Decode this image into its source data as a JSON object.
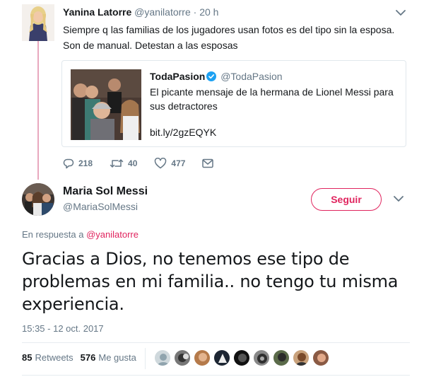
{
  "parent_tweet": {
    "name": "Yanina Latorre",
    "handle": "@yanilatorre",
    "separator": "·",
    "time": "20 h",
    "text": "Siempre q las familias de los jugadores usan fotos es del tipo sin la esposa. Son de manual. Detestan a las esposas",
    "quote": {
      "name": "TodaPasion",
      "handle": "@TodaPasion",
      "text": "El picante mensaje de la hermana de Lionel Messi para sus detractores",
      "link": "bit.ly/2gzEQYK"
    },
    "actions": {
      "replies": "218",
      "retweets": "40",
      "likes": "477"
    }
  },
  "main_tweet": {
    "name": "Maria Sol Messi",
    "handle": "@MariaSolMessi",
    "follow_label": "Seguir",
    "reply_prefix": "En respuesta a",
    "reply_mention": "@yanilatorre",
    "text": "Gracias a Dios, no tenemos ese tipo de problemas en mi familia.. no tengo tu misma experiencia.",
    "timestamp": "15:35 - 12 oct. 2017",
    "retweets_count": "85",
    "retweets_label": "Retweets",
    "likes_count": "576",
    "likes_label": "Me gusta"
  },
  "colors": {
    "accent": "#e0245e",
    "thread_line": "#e8a8be",
    "secondary_text": "#657786",
    "verified": "#1da1f2"
  },
  "icons": [
    "reply-icon",
    "retweet-icon",
    "like-icon",
    "message-icon",
    "chevron-down-icon",
    "verified-icon"
  ]
}
